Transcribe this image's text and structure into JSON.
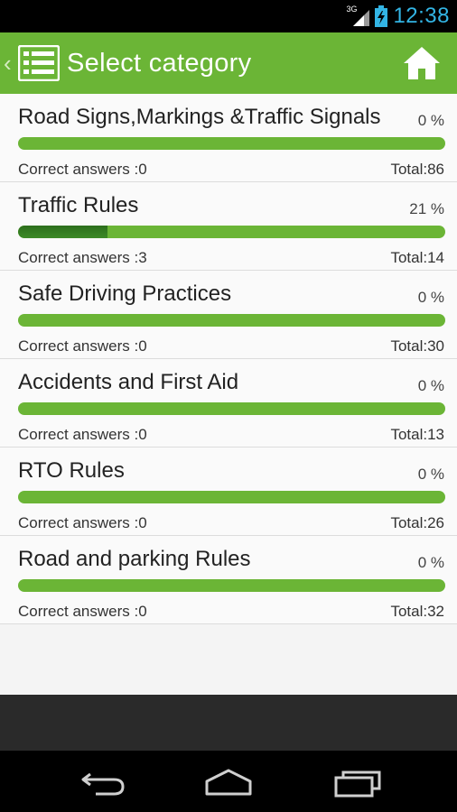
{
  "status_bar": {
    "network": "3G",
    "time": "12:38",
    "icons": [
      "signal-icon",
      "battery-charging-icon"
    ]
  },
  "action_bar": {
    "title": "Select category",
    "icons": [
      "up-caret-icon",
      "list-icon",
      "home-icon"
    ]
  },
  "categories": [
    {
      "name": "Road Signs,Markings &Traffic Signals",
      "percent_label": "0 %",
      "progress": 0.0,
      "correct_label": "Correct answers :0",
      "total_label": "Total:86"
    },
    {
      "name": "Traffic Rules",
      "percent_label": "21 %",
      "progress": 0.21,
      "correct_label": "Correct answers :3",
      "total_label": "Total:14"
    },
    {
      "name": "Safe Driving Practices",
      "percent_label": "0 %",
      "progress": 0.0,
      "correct_label": "Correct answers :0",
      "total_label": "Total:30"
    },
    {
      "name": "Accidents and First Aid",
      "percent_label": "0 %",
      "progress": 0.0,
      "correct_label": "Correct answers :0",
      "total_label": "Total:13"
    },
    {
      "name": "RTO Rules",
      "percent_label": "0 %",
      "progress": 0.0,
      "correct_label": "Correct answers :0",
      "total_label": "Total:26"
    },
    {
      "name": "Road and parking Rules",
      "percent_label": "0 %",
      "progress": 0.0,
      "correct_label": "Correct answers :0",
      "total_label": "Total:32"
    }
  ],
  "nav_bar": {
    "icons": [
      "back-icon",
      "home-nav-icon",
      "recent-apps-icon"
    ]
  },
  "colors": {
    "accent_green": "#6bb536",
    "progress_dark": "#2c6e1c",
    "status_blue": "#33b5e5"
  }
}
